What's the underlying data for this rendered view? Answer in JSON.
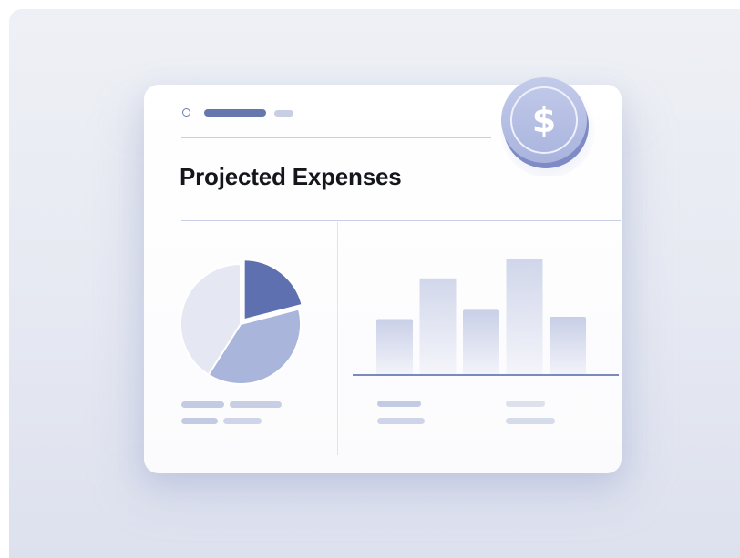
{
  "card": {
    "title": "Projected Expenses"
  },
  "coin": {
    "symbol": "$",
    "icon": "dollar-coin-icon"
  },
  "colors": {
    "accent": "#6677ad",
    "pie_dark": "#5f70b0",
    "pie_mid": "#a9b5db",
    "pie_light": "#e5e8f2",
    "bar_top": "#c7cee6",
    "bar_bottom": "#f5f6fb",
    "legend": "#c8cee3"
  },
  "pie": {
    "slices": [
      {
        "name": "slice-dark",
        "fraction": 0.21,
        "exploded": true
      },
      {
        "name": "slice-mid",
        "fraction": 0.38,
        "exploded": false
      },
      {
        "name": "slice-light",
        "fraction": 0.41,
        "exploded": false
      }
    ]
  },
  "bars": {
    "values": [
      0.48,
      0.83,
      0.56,
      1.0,
      0.5
    ],
    "shades": [
      0.45,
      0.18,
      0.45,
      0.22,
      0.5
    ]
  }
}
